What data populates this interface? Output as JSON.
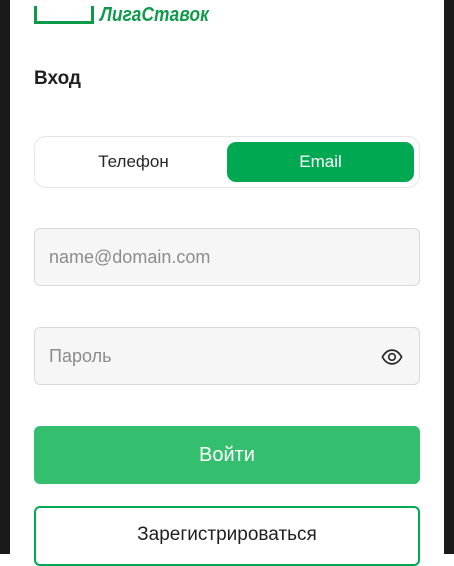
{
  "brand": {
    "name": "ЛигаСтавок",
    "color": "#0d9a4a"
  },
  "login": {
    "title": "Вход",
    "tabs": [
      {
        "label": "Телефон",
        "active": false
      },
      {
        "label": "Email",
        "active": true
      }
    ],
    "email": {
      "value": "",
      "placeholder": "name@domain.com"
    },
    "password": {
      "value": "",
      "placeholder": "Пароль",
      "toggle_icon": "eye-icon"
    },
    "submit_label": "Войти",
    "register_label": "Зарегистрироваться"
  },
  "colors": {
    "accent": "#00a851",
    "submit": "#34bf6e"
  }
}
